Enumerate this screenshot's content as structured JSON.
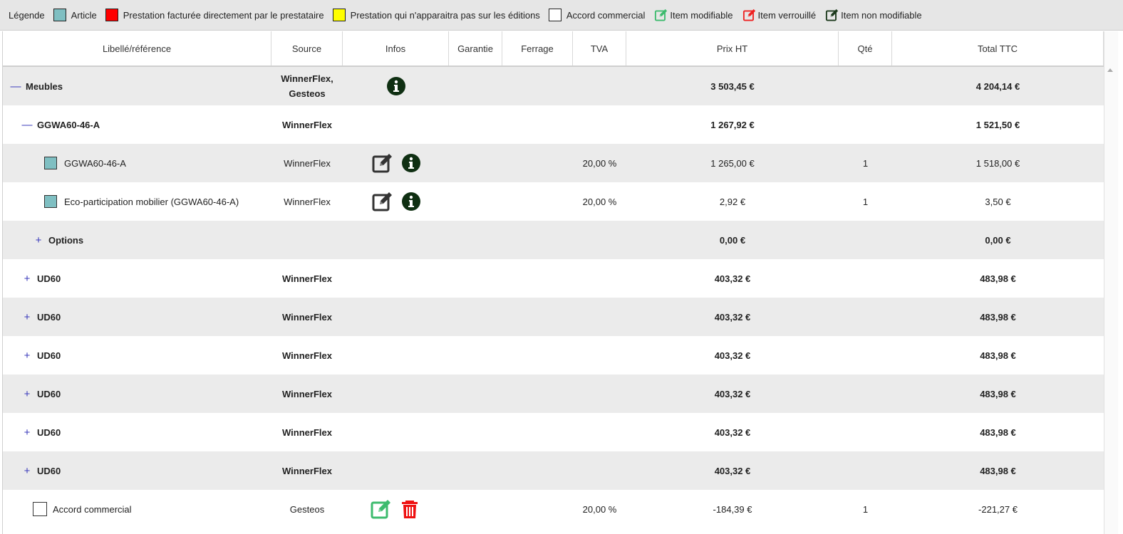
{
  "legend": {
    "title": "Légende",
    "items": [
      {
        "kind": "swatch",
        "color": "#7fbfc2",
        "label": "Article"
      },
      {
        "kind": "swatch",
        "color": "#ff0000",
        "label": "Prestation facturée directement par le prestataire"
      },
      {
        "kind": "swatch",
        "color": "#ffff00",
        "label": "Prestation qui n'apparaitra pas sur les éditions"
      },
      {
        "kind": "swatch",
        "color": "#ffffff",
        "label": "Accord commercial"
      },
      {
        "kind": "icon",
        "icon": "edit-icon",
        "color": "#3dbb6e",
        "label": "Item modifiable"
      },
      {
        "kind": "icon",
        "icon": "edit-icon",
        "color": "#ee2222",
        "label": "Item verrouillé"
      },
      {
        "kind": "icon",
        "icon": "edit-icon",
        "color": "#1c3a1c",
        "label": "Item non modifiable"
      }
    ]
  },
  "columns": [
    "Libellé/référence",
    "Source",
    "Infos",
    "Garantie",
    "Ferrage",
    "TVA",
    "Prix HT",
    "Qté",
    "Total TTC"
  ],
  "rows": [
    {
      "bg": "gray",
      "level": 0,
      "toggle": "—",
      "bold": true,
      "label": "Meubles",
      "source": [
        "WinnerFlex,",
        "Gesteos"
      ],
      "infos": [
        "info"
      ],
      "tva": "",
      "prix": "3 503,45 €",
      "qte": "",
      "total": "4 204,14 €"
    },
    {
      "bg": "white",
      "level": 1,
      "toggle": "—",
      "bold": true,
      "label": "GGWA60-46-A",
      "source": [
        "WinnerFlex"
      ],
      "infos": [],
      "tva": "",
      "prix": "1 267,92 €",
      "qte": "",
      "total": "1 521,50 €"
    },
    {
      "bg": "gray",
      "level": 2,
      "box": "article",
      "bold": false,
      "label": "GGWA60-46-A",
      "source": [
        "WinnerFlex"
      ],
      "infos": [
        "edit-dark",
        "info"
      ],
      "tva": "20,00 %",
      "prix": "1 265,00 €",
      "qte": "1",
      "total": "1 518,00 €"
    },
    {
      "bg": "white",
      "level": 2,
      "box": "article",
      "bold": false,
      "label": "Eco-participation mobilier (GGWA60-46-A)",
      "source": [
        "WinnerFlex"
      ],
      "infos": [
        "edit-dark",
        "info"
      ],
      "tva": "20,00 %",
      "prix": "2,92 €",
      "qte": "1",
      "total": "3,50 €"
    },
    {
      "bg": "gray",
      "level": 2,
      "toggle": "+",
      "bold": true,
      "label": "Options",
      "source": [],
      "infos": [],
      "tva": "",
      "prix": "0,00 €",
      "qte": "",
      "total": "0,00 €"
    },
    {
      "bg": "white",
      "level": 1,
      "toggle": "+",
      "bold": true,
      "label": "UD60",
      "source": [
        "WinnerFlex"
      ],
      "infos": [],
      "tva": "",
      "prix": "403,32 €",
      "qte": "",
      "total": "483,98 €"
    },
    {
      "bg": "gray",
      "level": 1,
      "toggle": "+",
      "bold": true,
      "label": "UD60",
      "source": [
        "WinnerFlex"
      ],
      "infos": [],
      "tva": "",
      "prix": "403,32 €",
      "qte": "",
      "total": "483,98 €"
    },
    {
      "bg": "white",
      "level": 1,
      "toggle": "+",
      "bold": true,
      "label": "UD60",
      "source": [
        "WinnerFlex"
      ],
      "infos": [],
      "tva": "",
      "prix": "403,32 €",
      "qte": "",
      "total": "483,98 €"
    },
    {
      "bg": "gray",
      "level": 1,
      "toggle": "+",
      "bold": true,
      "label": "UD60",
      "source": [
        "WinnerFlex"
      ],
      "infos": [],
      "tva": "",
      "prix": "403,32 €",
      "qte": "",
      "total": "483,98 €"
    },
    {
      "bg": "white",
      "level": 1,
      "toggle": "+",
      "bold": true,
      "label": "UD60",
      "source": [
        "WinnerFlex"
      ],
      "infos": [],
      "tva": "",
      "prix": "403,32 €",
      "qte": "",
      "total": "483,98 €"
    },
    {
      "bg": "gray",
      "level": 1,
      "toggle": "+",
      "bold": true,
      "label": "UD60",
      "source": [
        "WinnerFlex"
      ],
      "infos": [],
      "tva": "",
      "prix": "403,32 €",
      "qte": "",
      "total": "483,98 €"
    },
    {
      "bg": "white",
      "level": "ac",
      "box": "accord",
      "bold": false,
      "label": "Accord commercial",
      "source": [
        "Gesteos"
      ],
      "infos": [
        "edit-green",
        "delete"
      ],
      "tva": "20,00 %",
      "prix": "-184,39 €",
      "qte": "1",
      "total": "-221,27 €"
    }
  ]
}
